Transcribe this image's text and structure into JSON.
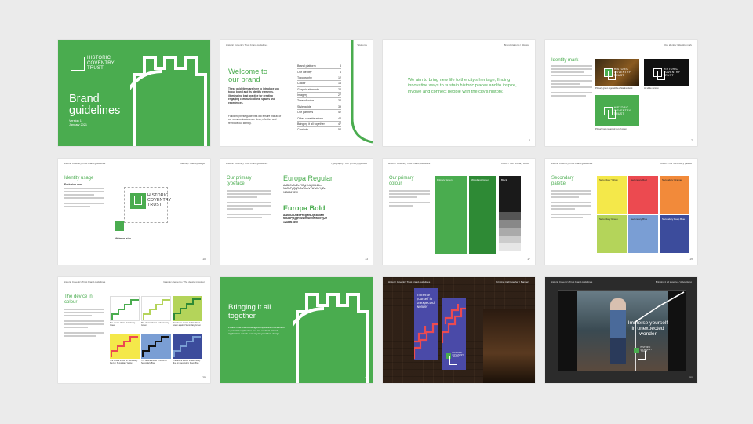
{
  "brand": {
    "primary_green": "#4aac4f",
    "dark_green": "#2e8a35",
    "logo_lines": [
      "HISTORIC",
      "COVENTRY",
      "TRUST"
    ]
  },
  "slides": {
    "s1": {
      "title": "Brand guidelines",
      "version": "Version 1",
      "date": "January 2021"
    },
    "s2": {
      "header": "Historic Coventry Trust brand guidelines",
      "header_right": "Welcome",
      "title": "Welcome to our brand",
      "body": "These guidelines are here to introduce you to our brand and its identity elements, illuminating best practice for creating engaging communications, spaces and experiences.",
      "body2": "Following these guidelines will ensure that all of our communications are clear, effective and reinforce our identity.",
      "contents": [
        {
          "label": "Brand platform",
          "page": "3"
        },
        {
          "label": "Our identity",
          "page": "6"
        },
        {
          "label": "Typography",
          "page": "12"
        },
        {
          "label": "Colour",
          "page": "16"
        },
        {
          "label": "Graphic elements",
          "page": "22"
        },
        {
          "label": "Imagery",
          "page": "27"
        },
        {
          "label": "Tone of voice",
          "page": "32"
        },
        {
          "label": "Style guide",
          "page": "39"
        },
        {
          "label": "Our partners",
          "page": "42"
        },
        {
          "label": "Other considerations",
          "page": "44"
        },
        {
          "label": "Bringing it all together",
          "page": "47"
        },
        {
          "label": "Contacts",
          "page": "54"
        }
      ],
      "page": "2"
    },
    "s3": {
      "header": "Brand platform / Mission",
      "text": "We aim to bring new life to the city's heritage, finding innovative ways to sustain historic places and to inspire, involve and connect people with the city's history.",
      "page": "4"
    },
    "s4": {
      "header": "Our identity / Identity mark",
      "title": "Identity mark",
      "cap1": "Primary green logo with a white knockout",
      "cap2": "All white version",
      "cap3": "Primary logo reversed out of green",
      "page": "7"
    },
    "s5": {
      "header": "Historic Coventry Trust brand guidelines",
      "header_right": "Identity / Identity usage",
      "title": "Identity usage",
      "sub": "Exclusion zone",
      "bottom_label": "Minimum size",
      "page": "10"
    },
    "s6": {
      "header": "Historic Coventry Trust brand guidelines",
      "header_right": "Typography / Our primary typeface",
      "title": "Our primary typeface",
      "font1": "Europa Regular",
      "font2": "Europa Bold",
      "alphabet_upper": "AaBbCcDdEeFfGgHhIiJjKkLlMm",
      "alphabet_lower": "NnOoPpQqRrSsTtUuVvWwXxYyZz",
      "digits": "1234567890",
      "page": "13"
    },
    "s7": {
      "header": "Historic Coventry Trust brand guidelines",
      "header_right": "Colour / Our primary colour",
      "title": "Our primary colour",
      "sw1": "Primary Green",
      "sw2": "Woodland Green",
      "sw3": "Black",
      "page": "17"
    },
    "s8": {
      "header": "Historic Coventry Trust brand guidelines",
      "header_right": "Colour / Our secondary palette",
      "title": "Secondary palette",
      "swatches": [
        "Secondary Yellow",
        "Secondary Red",
        "Secondary Orange",
        "Secondary Green",
        "Secondary Blue",
        "Secondary Deep Blue"
      ],
      "page": "19"
    },
    "s9": {
      "header": "Historic Coventry Trust brand guidelines",
      "header_right": "Graphic elements / The device in colour",
      "title": "The device in colour",
      "captions": [
        "The device shown in Primary Green",
        "The device shown in Secondary Green",
        "The device shown in Woodland Green against Secondary Green",
        "The device shown in Secondary Red on Secondary Yellow",
        "The device shown in Black on Secondary Blue",
        "The device shown in Secondary Blue on Secondary Deep Blue"
      ],
      "page": "25"
    },
    "s10": {
      "title": "Bringing it all together",
      "body": "Please note: the following examples are indicative of a potential application and are not final artwork. Application details currently beyond final design.",
      "page": "48"
    },
    "s11": {
      "header": "Historic Coventry Trust brand guidelines",
      "header_right": "Bringing it all together / Banners",
      "banner_text": "Immerse yourself in unexpected wonder"
    },
    "s12": {
      "header": "Historic Coventry Trust brand guidelines",
      "header_right": "Bringing it all together / Advertising",
      "ad_text": "Immerse yourself in unexpected wonder",
      "page": "50"
    }
  }
}
